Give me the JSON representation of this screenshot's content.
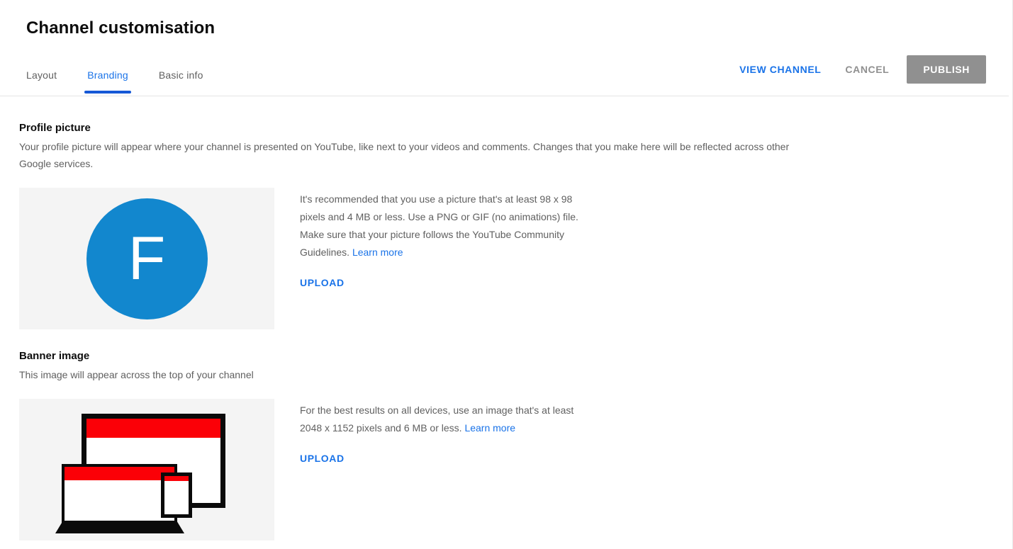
{
  "header": {
    "title": "Channel customisation",
    "tabs": [
      {
        "label": "Layout",
        "active": false
      },
      {
        "label": "Branding",
        "active": true
      },
      {
        "label": "Basic info",
        "active": false
      }
    ],
    "actions": {
      "view_channel": "VIEW CHANNEL",
      "cancel": "CANCEL",
      "publish": "PUBLISH"
    }
  },
  "colors": {
    "link_blue": "#1a73e8",
    "tab_underline": "#1558d6",
    "publish_bg": "#909090",
    "avatar_blue": "#1287ce",
    "device_red": "#fb0007",
    "placeholder_bg": "#f4f4f4"
  },
  "profile_picture": {
    "title": "Profile picture",
    "description": "Your profile picture will appear where your channel is presented on YouTube, like next to your videos and comments. Changes that you make here will be reflected across other Google services.",
    "avatar_initial": "F",
    "recommendation": "It's recommended that you use a picture that's at least 98 x 98 pixels and 4 MB or less. Use a PNG or GIF (no animations) file. Make sure that your picture follows the YouTube Community Guidelines.",
    "learn_more": "Learn more",
    "upload_label": "UPLOAD"
  },
  "banner_image": {
    "title": "Banner image",
    "description": "This image will appear across the top of your channel",
    "recommendation": "For the best results on all devices, use an image that's at least 2048 x 1152 pixels and 6 MB or less.",
    "learn_more": "Learn more",
    "upload_label": "UPLOAD"
  }
}
